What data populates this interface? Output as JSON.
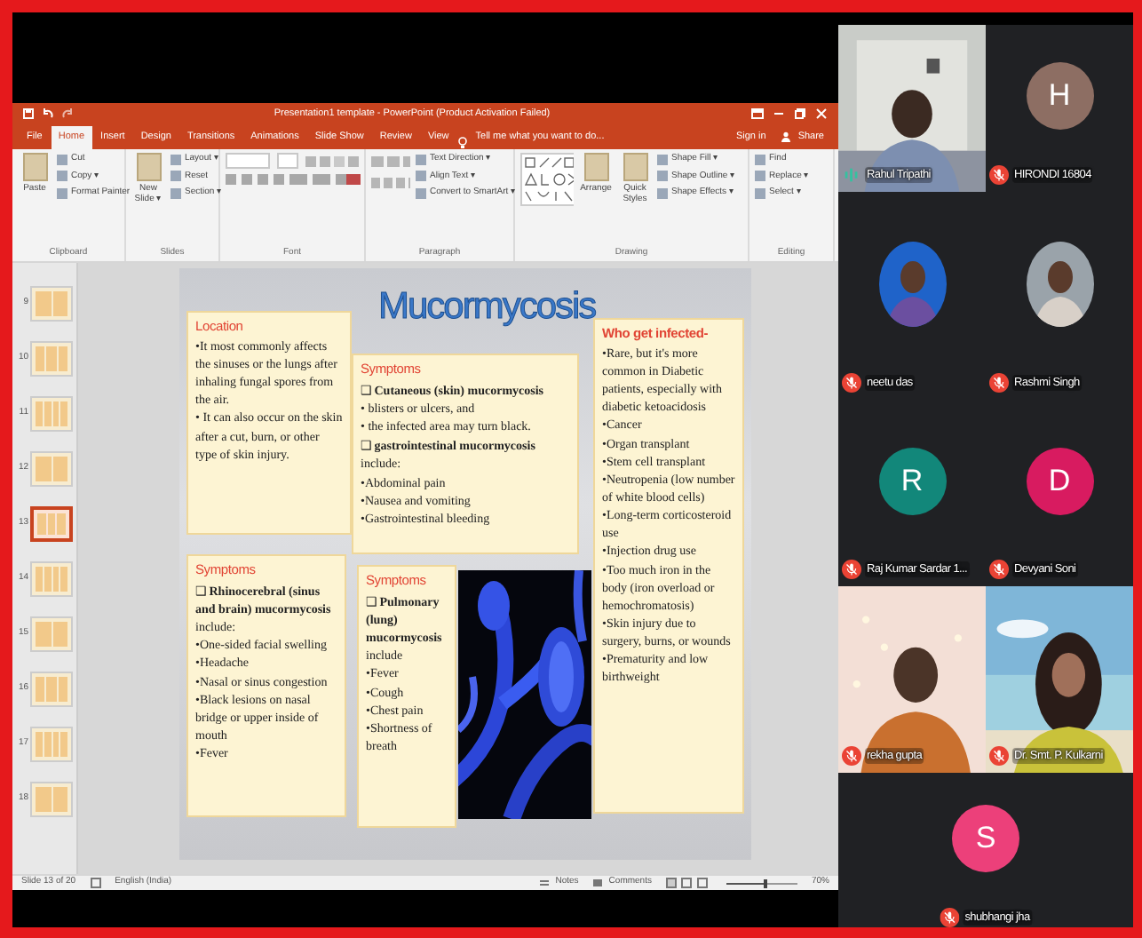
{
  "app_window": {
    "title": "Presentation1 template - PowerPoint (Product Activation Failed)",
    "tabs": [
      {
        "label": "File",
        "selected": false
      },
      {
        "label": "Home",
        "selected": true
      },
      {
        "label": "Insert",
        "selected": false
      },
      {
        "label": "Design",
        "selected": false
      },
      {
        "label": "Transitions",
        "selected": false
      },
      {
        "label": "Animations",
        "selected": false
      },
      {
        "label": "Slide Show",
        "selected": false
      },
      {
        "label": "Review",
        "selected": false
      },
      {
        "label": "View",
        "selected": false
      }
    ],
    "tell_me": "Tell me what you want to do...",
    "sign_in": "Sign in",
    "share": "Share"
  },
  "ribbon": {
    "groups": [
      {
        "label": "Clipboard",
        "kind": "buttons",
        "big": [
          "Paste"
        ],
        "items": [
          "Cut",
          "Copy ▾",
          "Format Painter"
        ]
      },
      {
        "label": "Slides",
        "kind": "buttons",
        "big": [
          "New Slide ▾"
        ],
        "items": [
          "Layout ▾",
          "Reset",
          "Section ▾"
        ]
      },
      {
        "label": "Font",
        "kind": "font"
      },
      {
        "label": "Paragraph",
        "kind": "paragraph",
        "items": [
          "Text Direction ▾",
          "Align Text ▾",
          "Convert to SmartArt ▾"
        ]
      },
      {
        "label": "Drawing",
        "kind": "drawing",
        "big": [
          "Arrange",
          "Quick Styles"
        ],
        "items": [
          "Shape Fill ▾",
          "Shape Outline ▾",
          "Shape Effects ▾"
        ]
      },
      {
        "label": "Editing",
        "kind": "buttons",
        "items": [
          "Find",
          "Replace ▾",
          "Select ▾"
        ]
      }
    ]
  },
  "thumbnails": [
    {
      "number": "9",
      "selected": false
    },
    {
      "number": "10",
      "selected": false
    },
    {
      "number": "11",
      "selected": false
    },
    {
      "number": "12",
      "selected": false
    },
    {
      "number": "13",
      "selected": true
    },
    {
      "number": "14",
      "selected": false
    },
    {
      "number": "15",
      "selected": false
    },
    {
      "number": "16",
      "selected": false
    },
    {
      "number": "17",
      "selected": false
    },
    {
      "number": "18",
      "selected": false
    }
  ],
  "slide": {
    "title": "Mucormycosis",
    "boxes": [
      {
        "heading": "Location",
        "items": [
          {
            "kind": "bullet",
            "text": "•It most commonly affects the sinuses or the lungs after inhaling fungal spores from the air."
          },
          {
            "kind": "bullet",
            "text": "• It can also occur on the skin after a cut, burn, or other type of skin injury."
          }
        ]
      },
      {
        "heading": "Symptoms",
        "items": [
          {
            "kind": "check",
            "text": "❑ **Cutaneous (skin) mucormycosis**"
          },
          {
            "kind": "bullet",
            "text": "•  blisters or ulcers, and"
          },
          {
            "kind": "bullet",
            "text": "•  the infected area may turn black."
          },
          {
            "kind": "check",
            "text": "❑ **gastrointestinal mucormycosis** include:"
          },
          {
            "kind": "bullet",
            "text": "•Abdominal pain"
          },
          {
            "kind": "bullet",
            "text": "•Nausea and vomiting"
          },
          {
            "kind": "bullet",
            "text": "•Gastrointestinal bleeding"
          }
        ]
      },
      {
        "heading": "Who get infected-",
        "items": [
          {
            "kind": "bullet",
            "text": "•Rare, but it's more common in Diabetic patients, especially with diabetic ketoacidosis"
          },
          {
            "kind": "bullet",
            "text": "•Cancer"
          },
          {
            "kind": "bullet",
            "text": "•Organ transplant"
          },
          {
            "kind": "bullet",
            "text": "•Stem cell transplant"
          },
          {
            "kind": "bullet",
            "text": "•Neutropenia  (low number of white blood cells)"
          },
          {
            "kind": "bullet",
            "text": "•Long-term corticosteroid use"
          },
          {
            "kind": "bullet",
            "text": "•Injection drug use"
          },
          {
            "kind": "bullet",
            "text": "•Too much iron in the body (iron overload or hemochromatosis)"
          },
          {
            "kind": "bullet",
            "text": "•Skin injury due to surgery, burns, or wounds"
          },
          {
            "kind": "bullet",
            "text": "•Prematurity and low birthweight"
          }
        ]
      },
      {
        "heading": "Symptoms",
        "items": [
          {
            "kind": "check",
            "text": "❑ **Rhinocerebral (sinus and brain) mucormycosis** include:"
          },
          {
            "kind": "bullet",
            "text": "•One-sided facial swelling"
          },
          {
            "kind": "bullet",
            "text": "•Headache"
          },
          {
            "kind": "bullet",
            "text": "•Nasal or sinus congestion"
          },
          {
            "kind": "bullet",
            "text": "•Black lesions on nasal bridge or upper inside of mouth"
          },
          {
            "kind": "bullet",
            "text": "•Fever"
          }
        ]
      },
      {
        "heading": "Symptoms",
        "items": [
          {
            "kind": "check",
            "text": "❑ **Pulmonary (lung) mucormycosis** include"
          },
          {
            "kind": "bullet",
            "text": "•Fever"
          },
          {
            "kind": "bullet",
            "text": "•Cough"
          },
          {
            "kind": "bullet",
            "text": "•Chest pain"
          },
          {
            "kind": "bullet",
            "text": "•Shortness of breath"
          }
        ]
      }
    ]
  },
  "status_bar": {
    "slide_info": "Slide 13 of 20",
    "language": "English (India)",
    "notes": "Notes",
    "comments": "Comments",
    "zoom_slider": {
      "level": 0.55
    },
    "zoom": "70%"
  },
  "participants": [
    {
      "name": "Rahul Tripathi",
      "kind": "video",
      "muted": false
    },
    {
      "name": "HIRONDI 16804",
      "kind": "letter",
      "letter": "H",
      "color": "#8d6e63",
      "muted": true
    },
    {
      "name": "neetu das",
      "muted": true
    },
    {
      "name": "Rashmi Singh",
      "muted": true
    },
    {
      "name": "Raj Kumar Sardar 1...",
      "kind": "letter",
      "letter": "R",
      "color": "#12877a",
      "muted": true
    },
    {
      "name": "Devyani Soni",
      "kind": "letter",
      "letter": "D",
      "color": "#d81b60",
      "muted": true
    },
    {
      "name": "rekha gupta",
      "kind": "video",
      "muted": true
    },
    {
      "name": "Dr. Smt. P. Kulkarni",
      "kind": "video",
      "muted": true
    },
    {
      "name": "shubhangi jha",
      "kind": "letter",
      "letter": "S",
      "color": "#ec407a",
      "muted": true
    }
  ]
}
